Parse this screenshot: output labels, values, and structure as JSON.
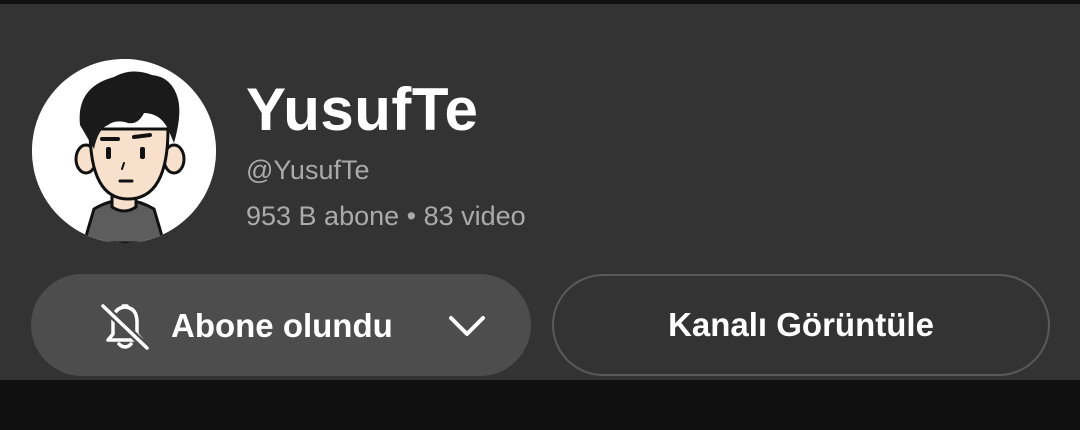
{
  "channel": {
    "name": "YusufTe",
    "handle": "@YusufTe",
    "stats": "953 B abone • 83 video"
  },
  "buttons": {
    "subscribed_label": "Abone olundu",
    "view_channel_label": "Kanalı Görüntüle"
  },
  "icons": {
    "notification": "bell-off-icon",
    "dropdown": "chevron-down-icon"
  },
  "colors": {
    "card_background": "#333333",
    "page_background": "#0f0f0f",
    "secondary_text": "#aaaaaa",
    "subscribed_button": "#4d4d4d"
  }
}
